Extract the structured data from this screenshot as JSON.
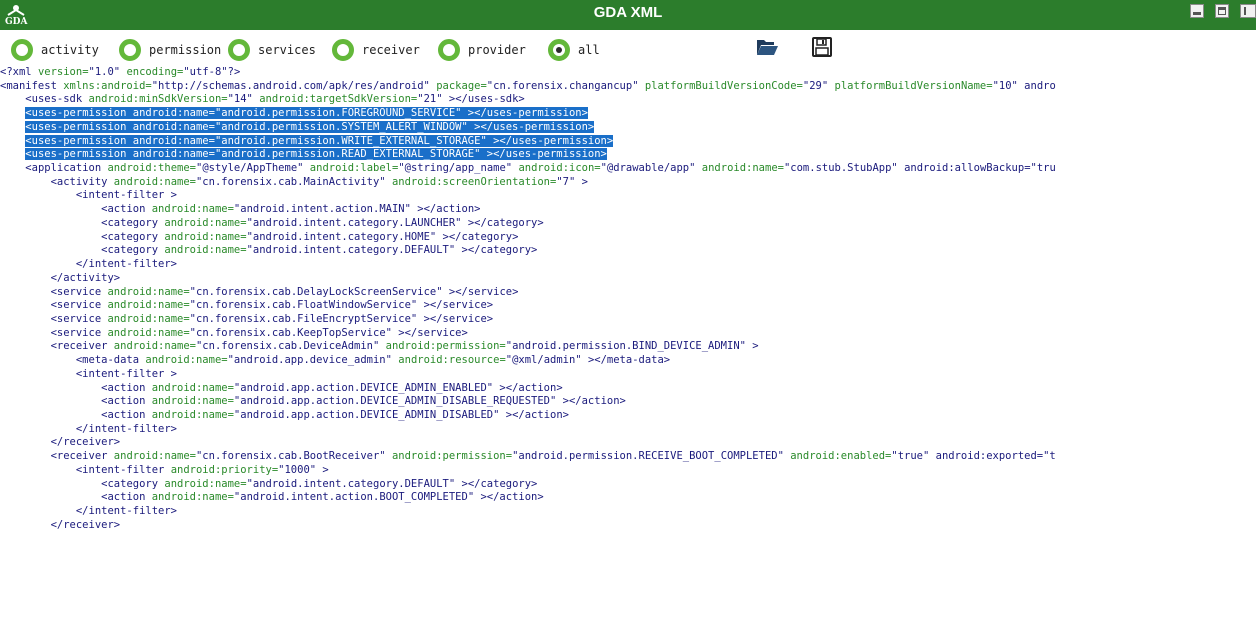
{
  "window": {
    "title": "GDA XML"
  },
  "filters": [
    {
      "label": "activity",
      "checked": false
    },
    {
      "label": "permission",
      "checked": false
    },
    {
      "label": "services",
      "checked": false
    },
    {
      "label": "receiver",
      "checked": false
    },
    {
      "label": "provider",
      "checked": false
    },
    {
      "label": "all",
      "checked": true
    }
  ],
  "toolbar": {
    "open_icon": "folder-open-icon",
    "save_icon": "floppy-disk-icon"
  },
  "colors": {
    "titlebar": "#2c7d2c",
    "radio_ring": "#63b83a",
    "selection": "#1a6fc9",
    "tag_text": "#1a1a7c",
    "attr_name": "#2a8a2a"
  },
  "xml_lines": [
    {
      "text": "<?xml version=\"1.0\" encoding=\"utf-8\"?>",
      "selected": false
    },
    {
      "text": "<manifest xmlns:android=\"http://schemas.android.com/apk/res/android\" package=\"cn.forensix.changancup\" platformBuildVersionCode=\"29\" platformBuildVersionName=\"10\" andro",
      "selected": false
    },
    {
      "text": "    <uses-sdk android:minSdkVersion=\"14\" android:targetSdkVersion=\"21\" ></uses-sdk>",
      "selected": false
    },
    {
      "text": "    <uses-permission android:name=\"android.permission.FOREGROUND_SERVICE\" ></uses-permission>",
      "selected": true
    },
    {
      "text": "    <uses-permission android:name=\"android.permission.SYSTEM_ALERT_WINDOW\" ></uses-permission>",
      "selected": true
    },
    {
      "text": "    <uses-permission android:name=\"android.permission.WRITE_EXTERNAL_STORAGE\" ></uses-permission>",
      "selected": true
    },
    {
      "text": "    <uses-permission android:name=\"android.permission.READ_EXTERNAL_STORAGE\" ></uses-permission>",
      "selected": true
    },
    {
      "text": "    <application android:theme=\"@style/AppTheme\" android:label=\"@string/app_name\" android:icon=\"@drawable/app\" android:name=\"com.stub.StubApp\" android:allowBackup=\"tru",
      "selected": false
    },
    {
      "text": "        <activity android:name=\"cn.forensix.cab.MainActivity\" android:screenOrientation=\"7\" >",
      "selected": false
    },
    {
      "text": "            <intent-filter >",
      "selected": false
    },
    {
      "text": "                <action android:name=\"android.intent.action.MAIN\" ></action>",
      "selected": false
    },
    {
      "text": "                <category android:name=\"android.intent.category.LAUNCHER\" ></category>",
      "selected": false
    },
    {
      "text": "                <category android:name=\"android.intent.category.HOME\" ></category>",
      "selected": false
    },
    {
      "text": "                <category android:name=\"android.intent.category.DEFAULT\" ></category>",
      "selected": false
    },
    {
      "text": "            </intent-filter>",
      "selected": false
    },
    {
      "text": "        </activity>",
      "selected": false
    },
    {
      "text": "        <service android:name=\"cn.forensix.cab.DelayLockScreenService\" ></service>",
      "selected": false
    },
    {
      "text": "        <service android:name=\"cn.forensix.cab.FloatWindowService\" ></service>",
      "selected": false
    },
    {
      "text": "        <service android:name=\"cn.forensix.cab.FileEncryptService\" ></service>",
      "selected": false
    },
    {
      "text": "        <service android:name=\"cn.forensix.cab.KeepTopService\" ></service>",
      "selected": false
    },
    {
      "text": "        <receiver android:name=\"cn.forensix.cab.DeviceAdmin\" android:permission=\"android.permission.BIND_DEVICE_ADMIN\" >",
      "selected": false
    },
    {
      "text": "            <meta-data android:name=\"android.app.device_admin\" android:resource=\"@xml/admin\" ></meta-data>",
      "selected": false
    },
    {
      "text": "            <intent-filter >",
      "selected": false
    },
    {
      "text": "                <action android:name=\"android.app.action.DEVICE_ADMIN_ENABLED\" ></action>",
      "selected": false
    },
    {
      "text": "                <action android:name=\"android.app.action.DEVICE_ADMIN_DISABLE_REQUESTED\" ></action>",
      "selected": false
    },
    {
      "text": "                <action android:name=\"android.app.action.DEVICE_ADMIN_DISABLED\" ></action>",
      "selected": false
    },
    {
      "text": "            </intent-filter>",
      "selected": false
    },
    {
      "text": "        </receiver>",
      "selected": false
    },
    {
      "text": "        <receiver android:name=\"cn.forensix.cab.BootReceiver\" android:permission=\"android.permission.RECEIVE_BOOT_COMPLETED\" android:enabled=\"true\" android:exported=\"t",
      "selected": false
    },
    {
      "text": "            <intent-filter android:priority=\"1000\" >",
      "selected": false
    },
    {
      "text": "                <category android:name=\"android.intent.category.DEFAULT\" ></category>",
      "selected": false
    },
    {
      "text": "                <action android:name=\"android.intent.action.BOOT_COMPLETED\" ></action>",
      "selected": false
    },
    {
      "text": "            </intent-filter>",
      "selected": false
    },
    {
      "text": "        </receiver>",
      "selected": false
    }
  ]
}
